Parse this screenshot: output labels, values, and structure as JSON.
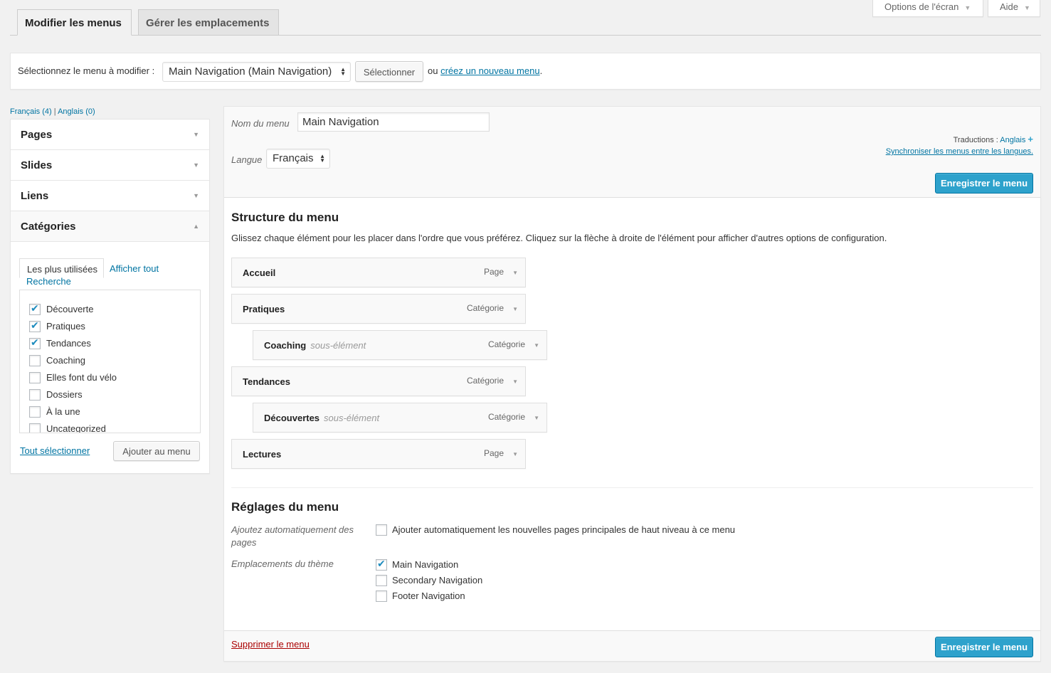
{
  "screen_options": {
    "label": "Options de l'écran"
  },
  "help": {
    "label": "Aide"
  },
  "tabs": [
    {
      "label": "Modifier les menus"
    },
    {
      "label": "Gérer les emplacements"
    }
  ],
  "select_bar": {
    "prompt": "Sélectionnez le menu à modifier :",
    "selected_menu": "Main Navigation (Main Navigation)",
    "select_button": "Sélectionner",
    "or_text": "ou",
    "create_link": "créez un nouveau menu",
    "period": "."
  },
  "languages": {
    "fr": "Français (4)",
    "sep": "|",
    "en": "Anglais (0)"
  },
  "accordion": [
    {
      "label": "Pages"
    },
    {
      "label": "Slides"
    },
    {
      "label": "Liens"
    },
    {
      "label": "Catégories"
    }
  ],
  "categories_panel": {
    "tab_most_used": "Les plus utilisées",
    "tab_show_all": "Afficher tout",
    "tab_search": "Recherche",
    "items": [
      {
        "label": "Découverte",
        "checked": true
      },
      {
        "label": "Pratiques",
        "checked": true
      },
      {
        "label": "Tendances",
        "checked": true
      },
      {
        "label": "Coaching",
        "checked": false
      },
      {
        "label": "Elles font du vélo",
        "checked": false
      },
      {
        "label": "Dossiers",
        "checked": false
      },
      {
        "label": "À la une",
        "checked": false
      },
      {
        "label": "Uncategorized",
        "checked": false
      }
    ],
    "select_all": "Tout sélectionner",
    "add_button": "Ajouter au menu"
  },
  "menu_editor": {
    "name_label": "Nom du menu",
    "name_value": "Main Navigation",
    "lang_label": "Langue",
    "lang_value": "Français",
    "translations_label": "Traductions :",
    "translations_link": "Anglais",
    "sync_link": "Synchroniser les menus entre les langues.",
    "save_button": "Enregistrer le menu",
    "structure_title": "Structure du menu",
    "structure_desc": "Glissez chaque élément pour les placer dans l'ordre que vous préférez. Cliquez sur la flèche à droite de l'élément pour afficher d'autres options de configuration.",
    "items": [
      {
        "title": "Accueil",
        "sub": "",
        "type": "Page",
        "depth": 0
      },
      {
        "title": "Pratiques",
        "sub": "",
        "type": "Catégorie",
        "depth": 0
      },
      {
        "title": "Coaching",
        "sub": "sous-élément",
        "type": "Catégorie",
        "depth": 1
      },
      {
        "title": "Tendances",
        "sub": "",
        "type": "Catégorie",
        "depth": 0
      },
      {
        "title": "Découvertes",
        "sub": "sous-élément",
        "type": "Catégorie",
        "depth": 1
      },
      {
        "title": "Lectures",
        "sub": "",
        "type": "Page",
        "depth": 0
      }
    ],
    "settings_title": "Réglages du menu",
    "auto_add_label": "Ajoutez automatiquement des pages",
    "auto_add_option": "Ajouter automatiquement les nouvelles pages principales de haut niveau à ce menu",
    "locations_label": "Emplacements du thème",
    "locations": [
      {
        "label": "Main Navigation",
        "checked": true
      },
      {
        "label": "Secondary Navigation",
        "checked": false
      },
      {
        "label": "Footer Navigation",
        "checked": false
      }
    ],
    "delete_link": "Supprimer le menu"
  },
  "colors": {
    "primary": "#2ea2cc",
    "link": "#0074a2",
    "delete": "#a00"
  }
}
